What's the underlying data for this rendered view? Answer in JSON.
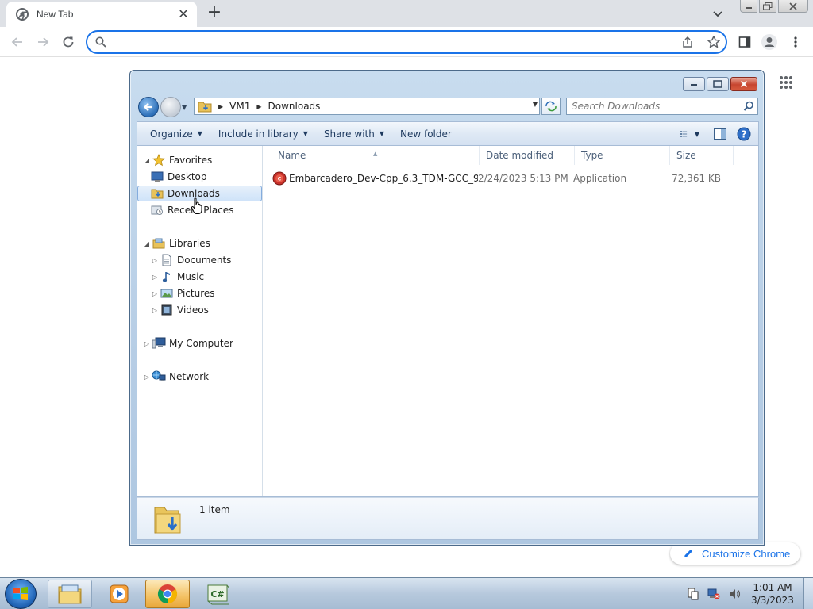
{
  "browser": {
    "tab_title": "New Tab",
    "omnibox_value": "",
    "customize_label": "Customize Chrome"
  },
  "explorer": {
    "breadcrumb": [
      "VM1",
      "Downloads"
    ],
    "search_placeholder": "Search Downloads",
    "commands": {
      "organize": "Organize",
      "include_in_library": "Include in library",
      "share_with": "Share with",
      "new_folder": "New folder"
    },
    "nav": {
      "favorites": "Favorites",
      "desktop": "Desktop",
      "downloads": "Downloads",
      "recent_places": "Recent Places",
      "libraries": "Libraries",
      "documents": "Documents",
      "music": "Music",
      "pictures": "Pictures",
      "videos": "Videos",
      "my_computer": "My Computer",
      "network": "Network"
    },
    "columns": {
      "name": "Name",
      "date_modified": "Date modified",
      "type": "Type",
      "size": "Size"
    },
    "files": [
      {
        "name": "Embarcadero_Dev-Cpp_6.3_TDM-GCC_9....",
        "date_modified": "2/24/2023 5:13 PM",
        "type": "Application",
        "size": "72,361 KB"
      }
    ],
    "status": "1 item"
  },
  "taskbar": {
    "time": "1:01 AM",
    "date": "3/3/2023"
  }
}
